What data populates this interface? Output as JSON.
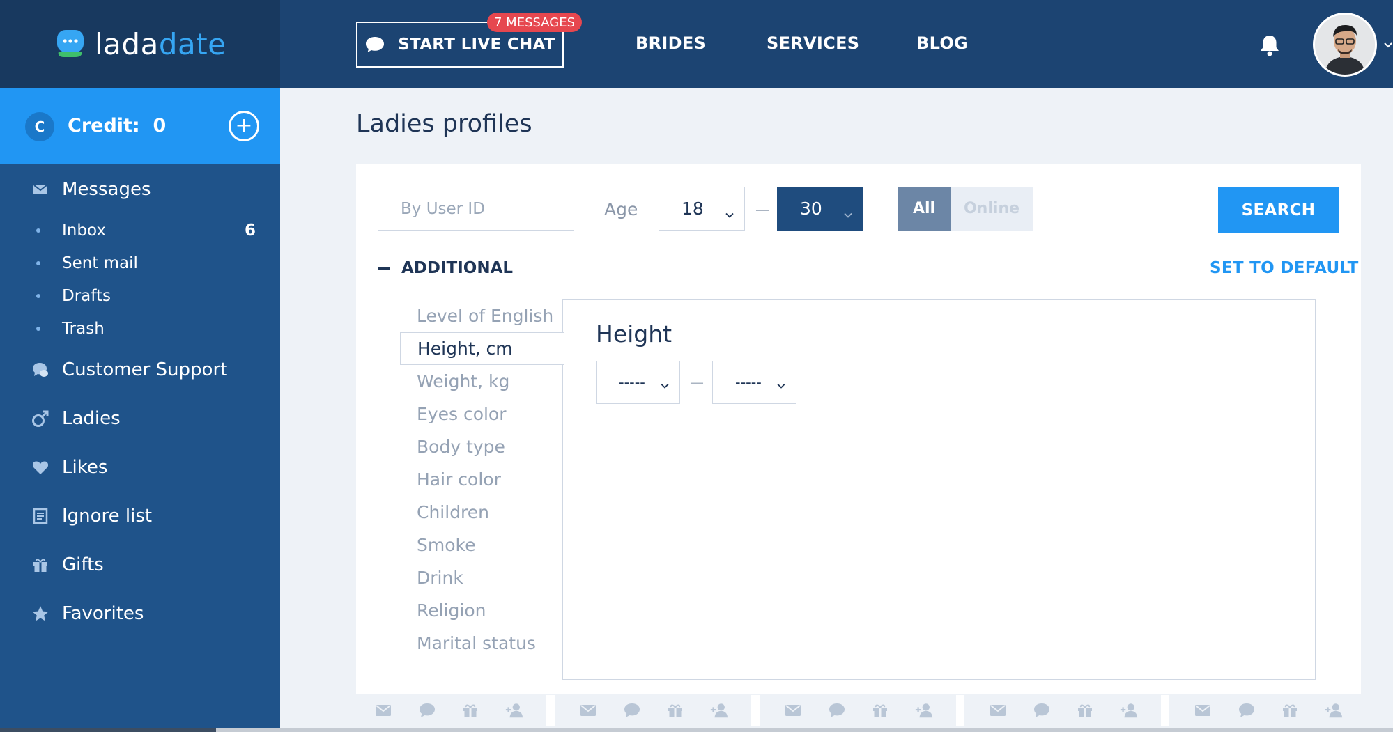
{
  "brand": {
    "part1": "lada",
    "part2": "date"
  },
  "header": {
    "chat_label": "START LIVE CHAT",
    "messages_badge": "7 MESSAGES",
    "nav": [
      "BRIDES",
      "SERVICES",
      "BLOG"
    ]
  },
  "sidebar": {
    "credit_label": "Credit:",
    "credit_value": "0",
    "credit_coin": "C",
    "credit_add": "+",
    "messages": "Messages",
    "submenu": [
      {
        "label": "Inbox",
        "count": "6"
      },
      {
        "label": "Sent mail",
        "count": ""
      },
      {
        "label": "Drafts",
        "count": ""
      },
      {
        "label": "Trash",
        "count": ""
      }
    ],
    "items": [
      "Customer Support",
      "Ladies",
      "Likes",
      "Ignore list",
      "Gifts",
      "Favorites"
    ]
  },
  "main": {
    "title": "Ladies profiles",
    "search_placeholder": "By User ID",
    "age_label": "Age",
    "age_from": "18",
    "age_to": "30",
    "range_dash": "—",
    "toggle_all": "All",
    "toggle_online": "Online",
    "search_button": "SEARCH",
    "additional": "ADDITIONAL",
    "set_default": "SET TO DEFAULT",
    "filters": [
      "Level of English",
      "Height, cm",
      "Weight, kg",
      "Eyes color",
      "Body type",
      "Hair color",
      "Children",
      "Smoke",
      "Drink",
      "Religion",
      "Marital status"
    ],
    "active_filter_index": 1,
    "detail_title": "Height",
    "height_from": "-----",
    "height_to": "-----"
  },
  "colors": {
    "header_bg": "#1c4472",
    "sidebar_bg": "#1f538a",
    "accent": "#2196f3",
    "badge": "#e6474f"
  }
}
